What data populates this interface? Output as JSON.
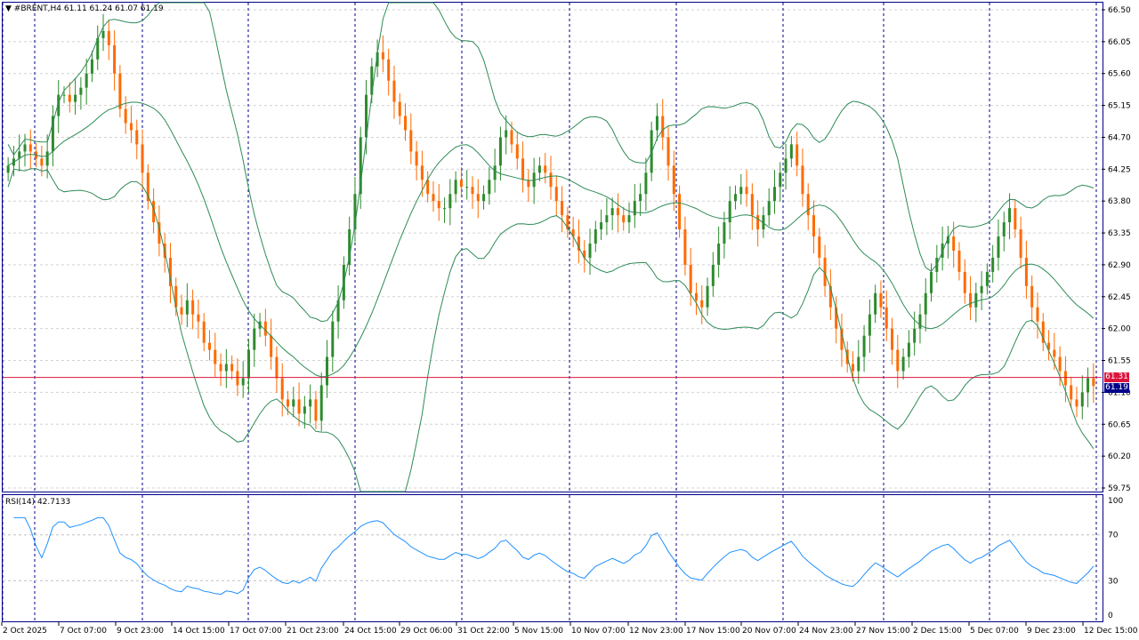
{
  "header": {
    "symbol_label": "#BRENT,H4",
    "ohlc": "61.11 61.24 61.07 61.19"
  },
  "rsi": {
    "label": "RSI(14) 42.7133",
    "levels": [
      100,
      70,
      30,
      0
    ]
  },
  "price_tags": {
    "red": "61.31",
    "current": "61.19"
  },
  "colors": {
    "bull": "#2e8b2e",
    "bear": "#ff6a00",
    "bands": "#2e8b57",
    "rsi_line": "#1e90ff",
    "red_line": "#dc143c",
    "current_tag": "#00008b"
  },
  "chart_data": [
    {
      "type": "candlestick",
      "symbol": "#BRENT",
      "timeframe": "H4",
      "ylim": [
        59.75,
        66.5
      ],
      "y_ticks": [
        "66.50",
        "66.05",
        "65.60",
        "65.15",
        "64.70",
        "64.25",
        "63.80",
        "63.35",
        "62.90",
        "62.45",
        "62.00",
        "61.55",
        "61.10",
        "60.65",
        "60.20",
        "59.75"
      ],
      "x_ticks": [
        "2 Oct 2025",
        "7 Oct 07:00",
        "9 Oct 23:00",
        "14 Oct 15:00",
        "17 Oct 07:00",
        "21 Oct 23:00",
        "24 Oct 15:00",
        "29 Oct 06:00",
        "31 Oct 22:00",
        "5 Nov 15:00",
        "10 Nov 07:00",
        "12 Nov 23:00",
        "17 Nov 15:00",
        "20 Nov 07:00",
        "24 Nov 23:00",
        "27 Nov 15:00",
        "2 Dec 15:00",
        "5 Dec 07:00",
        "9 Dec 23:00",
        "12 Dec 15:00"
      ],
      "close_series": [
        64.3,
        64.4,
        64.5,
        64.6,
        64.5,
        64.4,
        64.3,
        64.5,
        65.0,
        65.3,
        65.3,
        65.2,
        65.3,
        65.4,
        65.6,
        65.8,
        66.1,
        66.2,
        66.0,
        65.6,
        65.1,
        64.9,
        64.8,
        64.6,
        64.2,
        63.8,
        63.5,
        63.2,
        63.0,
        62.6,
        62.3,
        62.2,
        62.4,
        62.2,
        62.1,
        61.8,
        61.7,
        61.5,
        61.4,
        61.5,
        61.4,
        61.2,
        61.3,
        61.7,
        62.0,
        62.1,
        61.9,
        61.6,
        61.3,
        61.0,
        60.9,
        61.0,
        60.8,
        60.9,
        61.0,
        60.7,
        61.2,
        61.6,
        62.1,
        62.4,
        62.9,
        63.4,
        63.9,
        64.7,
        65.3,
        65.7,
        65.9,
        65.8,
        65.5,
        65.2,
        65.0,
        64.8,
        64.5,
        64.3,
        64.1,
        63.9,
        63.8,
        63.7,
        63.7,
        63.9,
        64.1,
        64.0,
        64.0,
        63.9,
        63.8,
        63.9,
        64.1,
        64.3,
        64.7,
        64.8,
        64.6,
        64.4,
        64.1,
        64.0,
        64.2,
        64.3,
        64.2,
        64.0,
        63.8,
        63.6,
        63.4,
        63.3,
        63.1,
        63.0,
        63.2,
        63.4,
        63.5,
        63.6,
        63.7,
        63.6,
        63.5,
        63.6,
        63.8,
        63.9,
        64.2,
        64.8,
        65.0,
        64.7,
        64.3,
        63.9,
        63.4,
        62.9,
        62.5,
        62.4,
        62.3,
        62.6,
        62.9,
        63.2,
        63.5,
        63.8,
        63.9,
        64.0,
        63.9,
        63.6,
        63.4,
        63.6,
        63.8,
        64.0,
        64.2,
        64.4,
        64.6,
        64.3,
        63.9,
        63.6,
        63.3,
        63.0,
        62.6,
        62.3,
        62.0,
        61.7,
        61.5,
        61.4,
        61.6,
        61.9,
        62.2,
        62.5,
        62.3,
        62.0,
        61.7,
        61.4,
        61.6,
        61.8,
        62.0,
        62.2,
        62.5,
        62.8,
        63.0,
        63.2,
        63.3,
        63.1,
        62.8,
        62.5,
        62.3,
        62.5,
        62.6,
        62.8,
        63.0,
        63.3,
        63.5,
        63.7,
        63.4,
        63.0,
        62.6,
        62.3,
        62.1,
        61.8,
        61.7,
        61.6,
        61.4,
        61.2,
        61.0,
        60.9,
        61.1,
        61.3,
        61.19
      ]
    },
    {
      "type": "line",
      "name": "RSI(14)",
      "ylim": [
        0,
        100
      ],
      "levels": [
        70,
        30
      ],
      "last": 42.7133
    }
  ]
}
